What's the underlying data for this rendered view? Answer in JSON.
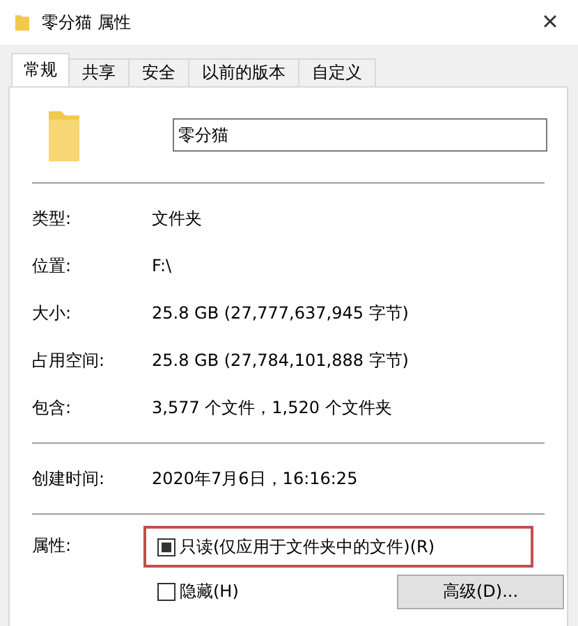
{
  "window": {
    "title": "零分猫 属性",
    "close": "×"
  },
  "tabs": [
    {
      "label": "常规",
      "selected": true
    },
    {
      "label": "共享",
      "selected": false
    },
    {
      "label": "安全",
      "selected": false
    },
    {
      "label": "以前的版本",
      "selected": false
    },
    {
      "label": "自定义",
      "selected": false
    }
  ],
  "name_field": {
    "value": "零分猫"
  },
  "groups": [
    [
      {
        "label": "类型:",
        "value": "文件夹"
      },
      {
        "label": "位置:",
        "value": "F:\\"
      },
      {
        "label": "大小:",
        "value": "25.8 GB (27,777,637,945 字节)"
      },
      {
        "label": "占用空间:",
        "value": "25.8 GB (27,784,101,888 字节)"
      },
      {
        "label": "包含:",
        "value": "3,577 个文件，1,520 个文件夹"
      }
    ],
    [
      {
        "label": "创建时间:",
        "value": "2020年7月6日，16:16:25"
      }
    ]
  ],
  "attributes": {
    "label": "属性:",
    "options": [
      {
        "label": "只读(仅应用于文件夹中的文件)(R)",
        "checked": false,
        "indeterminate": true,
        "highlighted": true
      },
      {
        "label": "隐藏(H)",
        "checked": false,
        "indeterminate": false,
        "highlighted": false
      }
    ],
    "advanced_button": "高级(D)..."
  }
}
